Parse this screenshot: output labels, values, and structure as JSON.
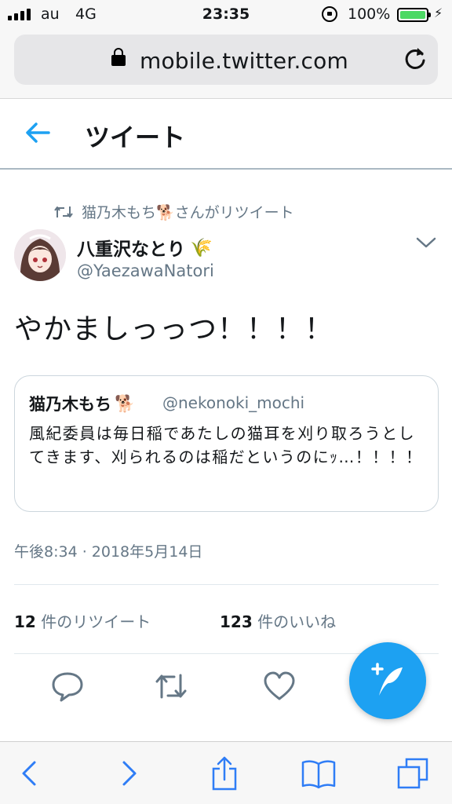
{
  "status_bar": {
    "carrier": "au",
    "network": "4G",
    "time": "23:35",
    "battery_percent": "100%",
    "battery_level": 1.0
  },
  "browser": {
    "url": "mobile.twitter.com"
  },
  "header": {
    "title": "ツイート"
  },
  "tweet": {
    "retweeted_by": "猫乃木もち🐕さんがリツイート",
    "author_name": "八重沢なとり",
    "author_emoji": "🌾",
    "author_handle": "@YaezawaNatori",
    "text": "やかましっっつ！！！！",
    "quoted": {
      "name": "猫乃木もち",
      "emoji": "🐕",
      "handle": "@nekonoki_mochi",
      "text": "風紀委員は毎日稲であたしの猫耳を刈り取ろうとしてきます、刈られるのは稲だというのにｯ…！！！！"
    },
    "timestamp": "午後8:34 · 2018年5月14日",
    "retweet_count": "12",
    "retweet_label": " 件のリツイート",
    "like_count": "123",
    "like_label": " 件のいいね"
  },
  "icons": {
    "reply": "reply-icon",
    "retweet": "retweet-icon",
    "like": "heart-icon",
    "compose": "compose-tweet-icon",
    "back": "back-arrow-icon"
  },
  "colors": {
    "accent": "#1da1f2",
    "muted": "#657786",
    "text": "#14171a",
    "safari_blue": "#2f7df6"
  }
}
